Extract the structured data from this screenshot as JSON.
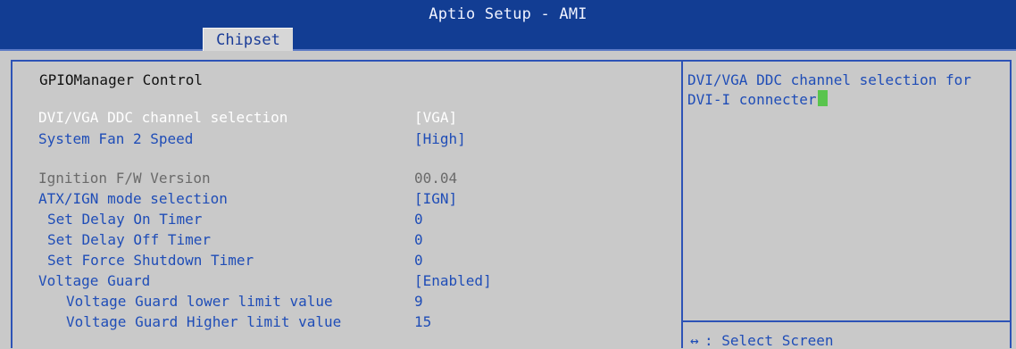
{
  "header": {
    "app_title": "Aptio Setup - AMI",
    "active_tab": "Chipset"
  },
  "main": {
    "section_title": "GPIOManager Control",
    "items": [
      {
        "label": "DVI/VGA DDC channel selection",
        "value": "[VGA]"
      },
      {
        "label": "System Fan 2 Speed",
        "value": "[High]"
      },
      {
        "label": "Ignition F/W Version",
        "value": "00.04"
      },
      {
        "label": "ATX/IGN mode selection",
        "value": "[IGN]"
      },
      {
        "label": "Set Delay On Timer",
        "value": "0"
      },
      {
        "label": "Set Delay Off Timer",
        "value": "0"
      },
      {
        "label": "Set Force Shutdown Timer",
        "value": "0"
      },
      {
        "label": "Voltage Guard",
        "value": "[Enabled]"
      },
      {
        "label": "Voltage Guard lower limit value",
        "value": "9"
      },
      {
        "label": "Voltage Guard Higher limit value",
        "value": "15"
      }
    ]
  },
  "help": {
    "text": "DVI/VGA DDC channel selection for DVI-I connecter",
    "footer_text": ": Select Screen",
    "footer_icon": "arrow-left-right-icon"
  },
  "colors": {
    "header_bg": "#123d93",
    "panel_bg": "#c9c9c9",
    "accent_blue": "#1f4db7",
    "cursor_green": "#59c44d"
  }
}
